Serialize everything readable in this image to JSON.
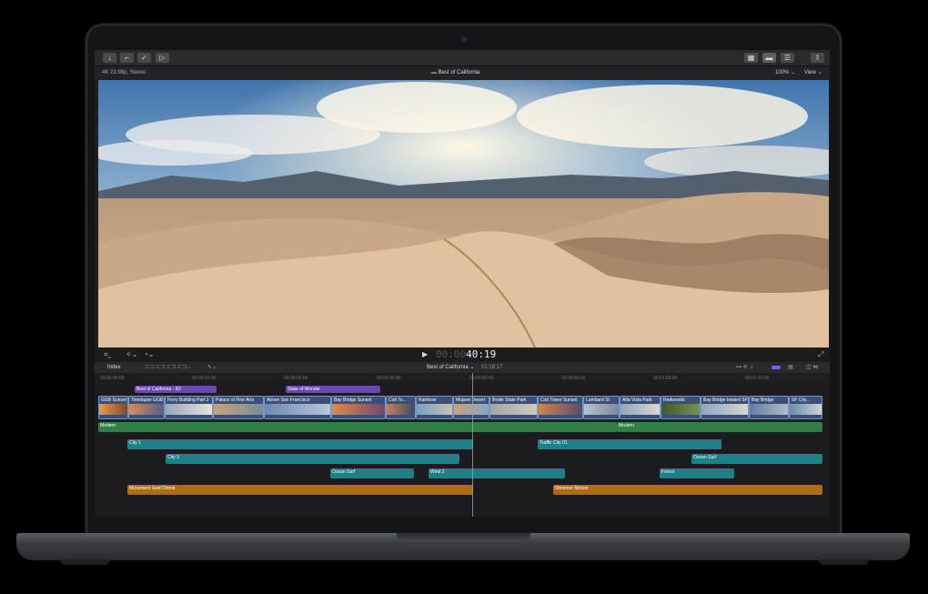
{
  "app": {
    "format_label": "4K 23.98p, Stereo",
    "project_title": "Best of California",
    "zoom": "100%",
    "view_label": "View",
    "timecode_dim": "00:00",
    "timecode": "40:19"
  },
  "toolbar": {
    "buttons": [
      "import",
      "keywords",
      "analyze",
      "share-export"
    ],
    "right_buttons": [
      "browser-layout",
      "timeline-layout",
      "inspector-layout",
      "share"
    ]
  },
  "timeline": {
    "index_label": "Index",
    "title": "Best of California",
    "duration": "01:18:17",
    "ruler": [
      "00:00:00:00",
      "00:00:10:00",
      "00:00:20:00",
      "00:00:30:00",
      "00:00:40:00",
      "00:00:50:00",
      "00:01:00:00",
      "00:01:10:00"
    ],
    "titles": [
      "Best of California - 3D",
      "State of Wonder"
    ],
    "clips": [
      "GGB Sunset",
      "Timelapse GGB",
      "Ferry Building Part 2",
      "Palace of Fine Arts",
      "Above San Francisco",
      "Bay Bridge Sunset",
      "Coit To...",
      "Rainbow",
      "Mojave Desert",
      "Bodie State Park",
      "Coit Tower Sunset",
      "Lombard St",
      "Alta Vista Park",
      "Redwoods",
      "Bay Bridge toward SF",
      "Bay Bridge",
      "SF City..."
    ],
    "audio": {
      "music1": "Modern",
      "music2": "Modern",
      "city1": "City 1",
      "traffic": "Traffic City 01",
      "city3": "City 3",
      "ocean1": "Ocean Surf",
      "ocean2": "Ocean Surf",
      "wind": "Wind 2",
      "forest": "Forest",
      "drone": "Movement Swirl Drone",
      "shimmer": "Shimmer Motion"
    }
  }
}
